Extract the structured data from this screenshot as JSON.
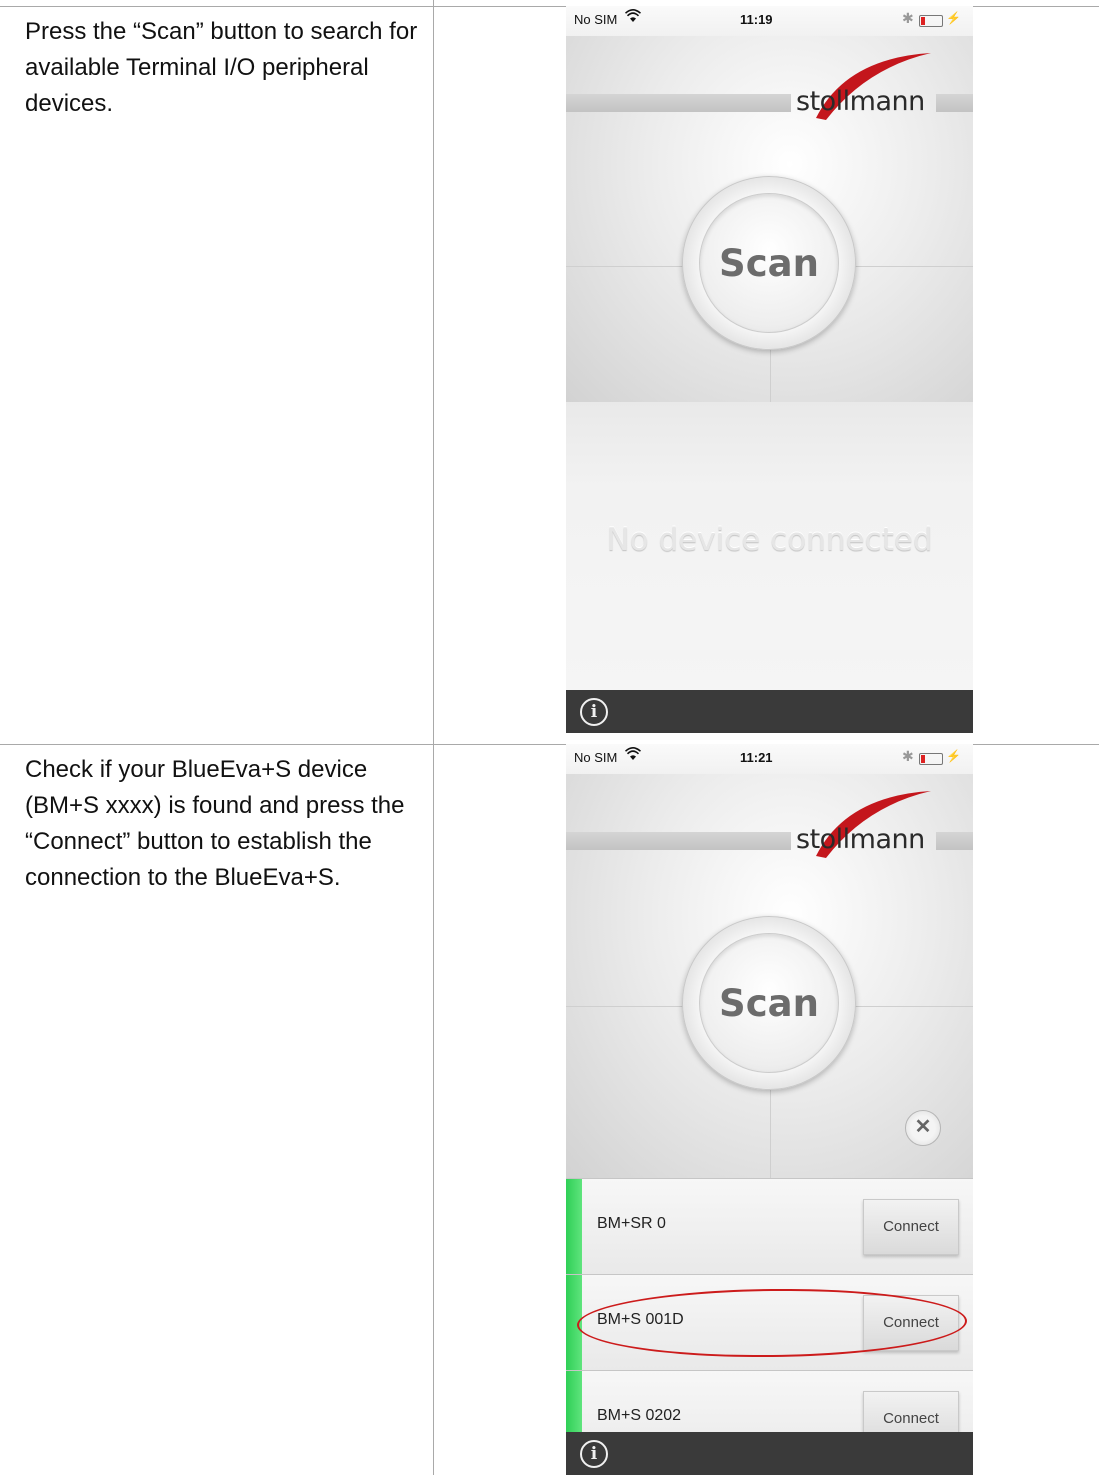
{
  "steps": [
    {
      "instruction": "Press the “Scan” button to search for available Terminal I/O peripheral devices.",
      "phone": {
        "carrier": "No SIM",
        "time": "11:19",
        "logo": "stollmann",
        "scan_label": "Scan",
        "status_message": "No device connected"
      }
    },
    {
      "instruction": "Check if your BlueEva+S device (BM+S xxxx) is found and press the “Connect” button to establish the connection to the BlueEva+S.",
      "phone": {
        "carrier": "No SIM",
        "time": "11:21",
        "logo": "stollmann",
        "scan_label": "Scan",
        "devices": [
          {
            "name": "BM+SR 0",
            "action": "Connect"
          },
          {
            "name": "BM+S 001D",
            "action": "Connect",
            "highlighted": true
          },
          {
            "name": "BM+S 0202",
            "action": "Connect"
          }
        ]
      }
    }
  ],
  "icons": {
    "wifi": "wifi-icon",
    "bluetooth": "bluetooth-icon",
    "battery": "battery-icon",
    "info": "info-icon",
    "close": "close-icon"
  },
  "colors": {
    "device_strip": "#2fcf56",
    "highlight": "#cc1b1b",
    "footer": "#3a3a3a",
    "battery_low": "#dd2222"
  }
}
